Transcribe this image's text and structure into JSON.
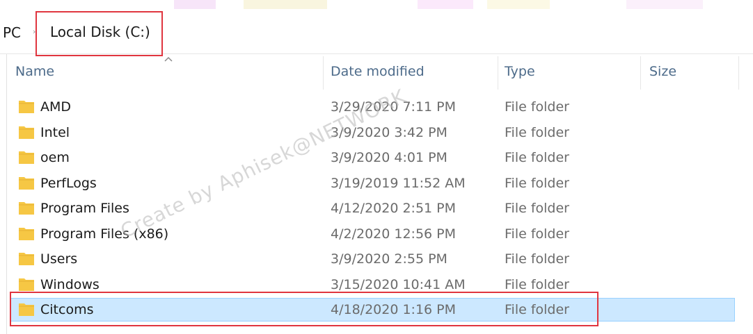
{
  "address": {
    "crumbs": [
      "PC",
      "Local Disk (C:)"
    ],
    "separator": "›"
  },
  "columns": [
    {
      "label": "Name"
    },
    {
      "label": "Date modified"
    },
    {
      "label": "Type"
    },
    {
      "label": "Size"
    }
  ],
  "rows": [
    {
      "name": "AMD",
      "date": "3/29/2020 7:11 PM",
      "type": "File folder",
      "size": ""
    },
    {
      "name": "Intel",
      "date": "3/9/2020 3:42 PM",
      "type": "File folder",
      "size": ""
    },
    {
      "name": "oem",
      "date": "3/9/2020 4:01 PM",
      "type": "File folder",
      "size": ""
    },
    {
      "name": "PerfLogs",
      "date": "3/19/2019 11:52 AM",
      "type": "File folder",
      "size": ""
    },
    {
      "name": "Program Files",
      "date": "4/12/2020 2:51 PM",
      "type": "File folder",
      "size": ""
    },
    {
      "name": "Program Files (x86)",
      "date": "4/2/2020 12:56 PM",
      "type": "File folder",
      "size": ""
    },
    {
      "name": "Users",
      "date": "3/9/2020 2:55 PM",
      "type": "File folder",
      "size": ""
    },
    {
      "name": "Windows",
      "date": "3/15/2020 10:41 AM",
      "type": "File folder",
      "size": ""
    },
    {
      "name": "Citcoms",
      "date": "4/18/2020 1:16 PM",
      "type": "File folder",
      "size": "",
      "selected": true
    }
  ],
  "watermark": "Create by Aphisek@NETWORK",
  "colors": {
    "highlight": "#e0353f",
    "selection": "#cce8ff",
    "folder": "#f6c744",
    "header_text": "#4d6b8a"
  },
  "icons": {
    "folder": "folder-icon",
    "sort": "sort-up-icon",
    "separator": "chevron-right-icon"
  }
}
